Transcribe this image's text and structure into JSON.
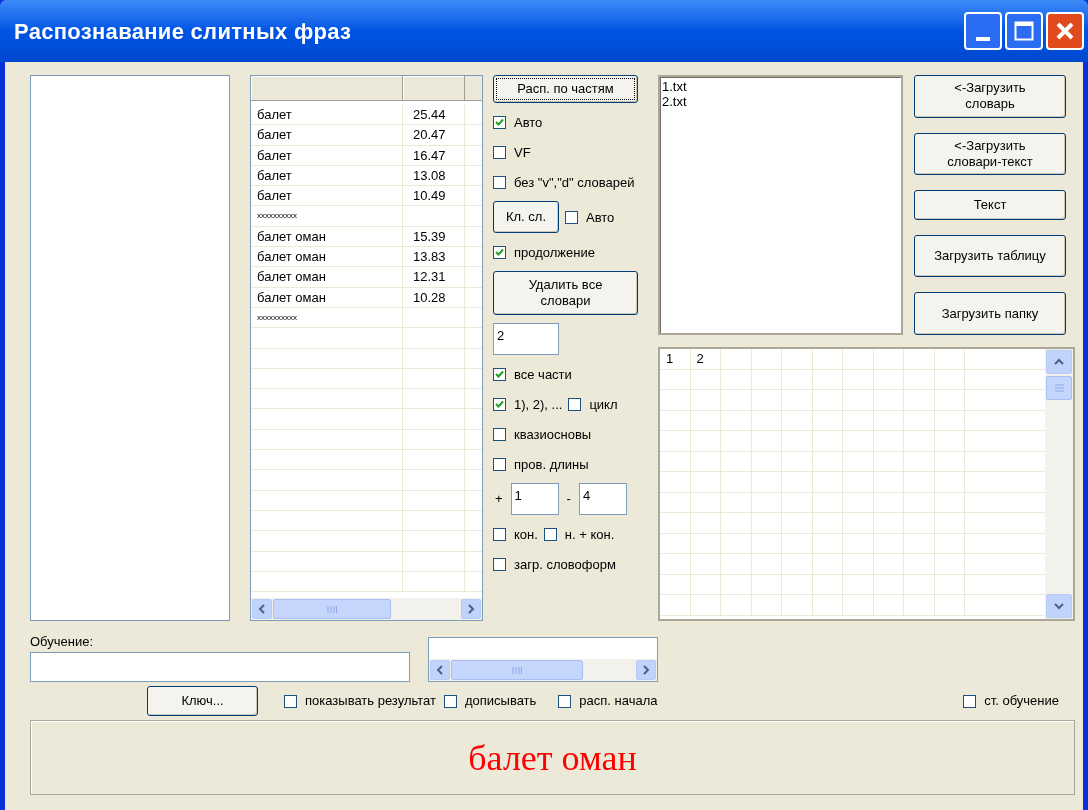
{
  "window": {
    "title": "Распознавание слитных фраз"
  },
  "results_table": {
    "rows": [
      {
        "kind": "row",
        "word": "балет",
        "score": "25.44"
      },
      {
        "kind": "row",
        "word": "балет",
        "score": "20.47"
      },
      {
        "kind": "row",
        "word": "балет",
        "score": "16.47"
      },
      {
        "kind": "row",
        "word": "балет",
        "score": "13.08"
      },
      {
        "kind": "row",
        "word": "балет",
        "score": "10.49"
      },
      {
        "kind": "separator",
        "word": "xxxxxxxxxx"
      },
      {
        "kind": "row",
        "word": "балет оман",
        "score": "15.39"
      },
      {
        "kind": "row",
        "word": "балет оман",
        "score": "13.83"
      },
      {
        "kind": "row",
        "word": "балет оман",
        "score": "12.31"
      },
      {
        "kind": "row",
        "word": "балет оман",
        "score": "10.28"
      },
      {
        "kind": "separator",
        "word": "xxxxxxxxxx"
      }
    ]
  },
  "controls": [
    {
      "kind": "button",
      "label": "Расп. по частям",
      "focused": true
    },
    {
      "kind": "checkbox",
      "label": "Авто",
      "checked": true
    },
    {
      "kind": "checkbox",
      "label": "VF",
      "checked": false
    },
    {
      "kind": "checkbox",
      "label": "без \"v\",\"d\" словарей",
      "checked": false
    },
    {
      "kind": "row",
      "items": [
        {
          "kind": "button",
          "label": "Кл. сл.",
          "focused": false
        },
        {
          "kind": "checkbox",
          "label": "Авто",
          "checked": false
        }
      ]
    },
    {
      "kind": "checkbox",
      "label": "продолжение",
      "checked": true
    },
    {
      "kind": "button",
      "label": "Удалить все словари",
      "focused": false
    },
    {
      "kind": "field",
      "value": "2"
    },
    {
      "kind": "checkbox",
      "label": "все части",
      "checked": true
    },
    {
      "kind": "row",
      "items": [
        {
          "kind": "checkbox",
          "label": "1), 2), ...",
          "checked": true
        },
        {
          "kind": "checkbox",
          "label": "цикл",
          "checked": false
        }
      ]
    },
    {
      "kind": "checkbox",
      "label": "квазиосновы",
      "checked": false
    },
    {
      "kind": "checkbox",
      "label": "пров. длины",
      "checked": false
    },
    {
      "kind": "row",
      "items": [
        {
          "kind": "text",
          "text": "+"
        },
        {
          "kind": "field",
          "value": "1"
        },
        {
          "kind": "text",
          "text": "-"
        },
        {
          "kind": "field",
          "value": "4"
        }
      ]
    },
    {
      "kind": "row",
      "items": [
        {
          "kind": "checkbox",
          "label": "кон.",
          "checked": false
        },
        {
          "kind": "checkbox",
          "label": "н. + кон.",
          "checked": false
        }
      ]
    },
    {
      "kind": "checkbox",
      "label": "загр. словоформ",
      "checked": false
    }
  ],
  "files": [
    "1.txt",
    "2.txt"
  ],
  "side_buttons": [
    "<-Загрузить словарь",
    "<-Загрузить словари-текст",
    "Текст",
    "Загрузить таблицу",
    "Загрузить папку"
  ],
  "grid": {
    "cells": [
      "1",
      "2"
    ]
  },
  "training": {
    "label": "Обучение:"
  },
  "key_button": "Ключ...",
  "options": [
    {
      "label": "показывать результат",
      "checked": false
    },
    {
      "label": "дописывать",
      "checked": false
    },
    {
      "label": "расп. начала",
      "checked": false
    }
  ],
  "st_training": {
    "label": "ст. обучение",
    "checked": false
  },
  "result": "балет оман"
}
